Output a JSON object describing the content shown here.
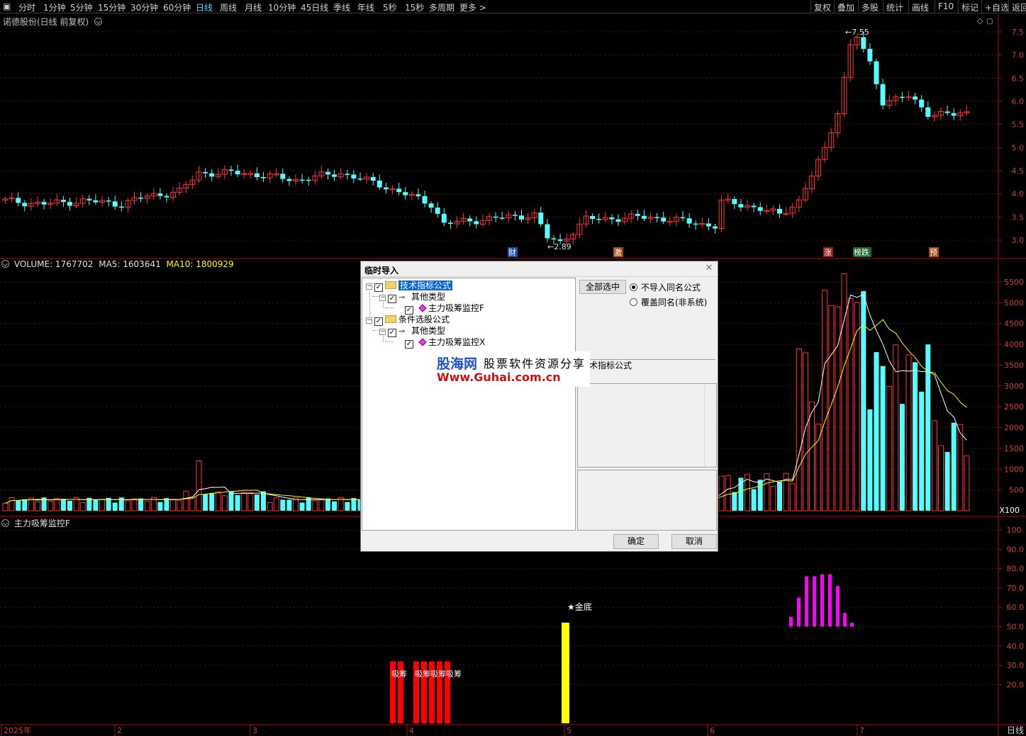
{
  "toolbar": {
    "periods": [
      "分时",
      "1分钟",
      "5分钟",
      "15分钟",
      "30分钟",
      "60分钟",
      "日线",
      "周线",
      "月线",
      "10分钟",
      "45日线",
      "季线",
      "年线",
      "5秒",
      "15秒",
      "多周期",
      "更多 >"
    ],
    "active": "日线",
    "right_items": [
      "复权",
      "叠加",
      "多股",
      "统计",
      "画线",
      "F10",
      "标记",
      "+自选",
      "返回"
    ]
  },
  "main_pane": {
    "title": "诺德股份(日线 前复权)",
    "high_label": "7.55",
    "low_label": "2.89",
    "price_axis": [
      "7.5",
      "7.0",
      "6.5",
      "6.0",
      "5.5",
      "5.0",
      "4.5",
      "4.0",
      "3.5",
      "3.0"
    ],
    "event_badges": [
      "财",
      "激",
      "涨",
      "榜跌",
      "预"
    ]
  },
  "volume_pane": {
    "volume_label": "VOLUME: 1767702",
    "ma5_label": "MA5: 1603641",
    "ma10_label": "MA10: 1800929",
    "axis": [
      "5500",
      "5000",
      "4500",
      "4000",
      "3500",
      "3000",
      "2500",
      "2000",
      "1500",
      "1000",
      "500"
    ],
    "unit": "X100"
  },
  "indicator_pane": {
    "title": "主力吸筹监控F",
    "axis": [
      "100.",
      "90.0",
      "80.0",
      "70.0",
      "60.0",
      "50.0",
      "40.0",
      "30.0",
      "20.0"
    ],
    "signal_text": "吸筹",
    "gold_label": "★金底"
  },
  "date_axis": [
    "2025年",
    "2",
    "3",
    "4",
    "5",
    "6",
    "7"
  ],
  "period_label": "日线",
  "dialog": {
    "title": "临时导入",
    "tree": {
      "root1": "技术指标公式",
      "root1_sub": "其他类型",
      "root1_item": "主力吸筹监控F",
      "root2": "条件选股公式",
      "root2_sub": "其他类型",
      "root2_item": "主力吸筹监控X"
    },
    "select_all": "全部选中",
    "radio_no_import": "不导入同名公式",
    "radio_overwrite": "覆盖同名(非系统)",
    "type_label": "术指标公式",
    "ok": "确定",
    "cancel": "取消"
  },
  "watermark": {
    "brand": "股海网",
    "slogan": "股票软件资源分享",
    "url": "Www.Guhai.com.cn"
  },
  "colors": {
    "up": "#ff3232",
    "down": "#54ffff",
    "ma5": "#ffffff",
    "ma10": "#ffff00",
    "signal": "#ff0000",
    "gold": "#ffff00",
    "magenta": "#ff00ff"
  }
}
